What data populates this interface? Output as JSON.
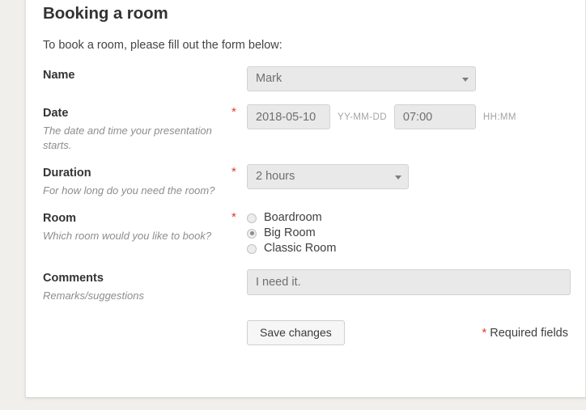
{
  "page": {
    "title": "Booking a room",
    "intro": "To book a room, please fill out the form below:"
  },
  "form": {
    "name": {
      "label": "Name",
      "required": false,
      "selected_value": "Mark"
    },
    "date": {
      "label": "Date",
      "required_marker": "*",
      "help": "The date and time your presentation starts.",
      "date_value": "2018-05-10",
      "date_format_hint": "YY-MM-DD",
      "time_value": "07:00",
      "time_format_hint": "HH:MM"
    },
    "duration": {
      "label": "Duration",
      "required_marker": "*",
      "help": "For how long do you need the room?",
      "selected_value": "2 hours"
    },
    "room": {
      "label": "Room",
      "required_marker": "*",
      "help": "Which room would you like to book?",
      "options": [
        {
          "label": "Boardroom",
          "selected": false
        },
        {
          "label": "Big Room",
          "selected": true
        },
        {
          "label": "Classic Room",
          "selected": false
        }
      ]
    },
    "comments": {
      "label": "Comments",
      "help": "Remarks/suggestions",
      "value": "I need it."
    }
  },
  "footer": {
    "save_label": "Save changes",
    "required_marker": "*",
    "required_note": "Required fields"
  },
  "colors": {
    "page_background": "#f0efeb",
    "card_background": "#ffffff",
    "required_red": "#e23b28",
    "label_text": "#333333",
    "help_text": "#8d8d8d",
    "input_background": "#e9e9e9"
  }
}
